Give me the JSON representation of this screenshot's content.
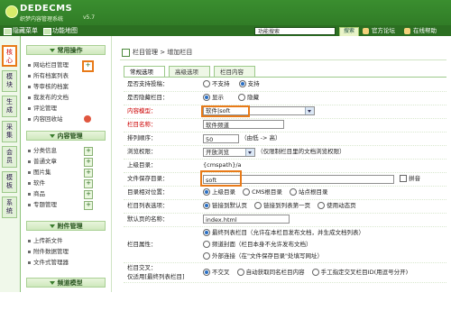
{
  "app": {
    "logo_text": "DEDECMS",
    "logo_sub": "织梦内容管理系统",
    "version": "v5.7"
  },
  "nav": {
    "items": [
      "隐藏菜单",
      "功能地图"
    ],
    "search_value": "功能搜索",
    "search_button": "搜索",
    "links": [
      "官方论坛",
      "在线帮助"
    ]
  },
  "vtabs": [
    "核心",
    "模块",
    "生成",
    "采集",
    "会员",
    "模板",
    "系统"
  ],
  "side": {
    "sections": [
      "常用操作",
      "内容管理",
      "附件管理",
      "频道模型"
    ],
    "common": [
      "网站栏目管理",
      "所有档案列表",
      "等审核的档案",
      "我发布的文档",
      "评论管理",
      "内容回收站"
    ],
    "content": [
      "分类信息",
      "普通文章",
      "图片集",
      "软件",
      "商品",
      "专题管理"
    ],
    "attach": [
      "上传新文件",
      "附件数据管理",
      "文件式管理器"
    ]
  },
  "main": {
    "breadcrumb": "栏目管理 > 增加栏目",
    "tabs": [
      "常规选项",
      "高级选项",
      "栏目内容"
    ],
    "rows": {
      "support_post": {
        "label": "是否支持投稿：",
        "opts": [
          "不支持",
          "支持"
        ]
      },
      "hidden": {
        "label": "是否隐藏栏目：",
        "opts": [
          "显示",
          "隐藏"
        ]
      },
      "model": {
        "label": "内容模型：",
        "value": "软件|soft"
      },
      "name": {
        "label": "栏目名称：",
        "value": "软件频道"
      },
      "order": {
        "label": "排列顺序：",
        "value": "50",
        "hint": "（由低 -> 高）"
      },
      "access": {
        "label": "浏览权限：",
        "value": "开放浏览",
        "hint": "（仅限制栏目里的文档浏览权限）"
      },
      "parent": {
        "label": "上级目录：",
        "value": "{cmspath}/a"
      },
      "dir": {
        "label": "文件保存目录：",
        "value": "soft",
        "pinyin": "拼音"
      },
      "rel": {
        "label": "目录相对位置：",
        "opts": [
          "上级目录",
          "CMS根目录",
          "站点根目录"
        ]
      },
      "list": {
        "label": "栏目列表选项：",
        "opts": [
          "链接到默认页",
          "链接到列表第一页",
          "使用动态页"
        ]
      },
      "index": {
        "label": "默认页的名称：",
        "value": "index.html"
      },
      "attr": {
        "label": "栏目属性：",
        "opts": [
          "最终列表栏目（允许在本栏目发布文档，并生成文档列表）",
          "频道封面（栏目本身不允许发布文档）",
          "外部连接（在\"文件保存目录\"处填写网址）"
        ]
      },
      "cross": {
        "label": "栏目交叉：",
        "label2": "仅适用[最终列表栏目]",
        "opts": [
          "不交叉",
          "自动获取同名栏目内容",
          "手工指定交叉栏目ID(用逗号分开)"
        ]
      }
    }
  },
  "colors": {
    "brand": "#3a8e2f",
    "highlight": "#e87a18",
    "required": "#cc0000"
  }
}
